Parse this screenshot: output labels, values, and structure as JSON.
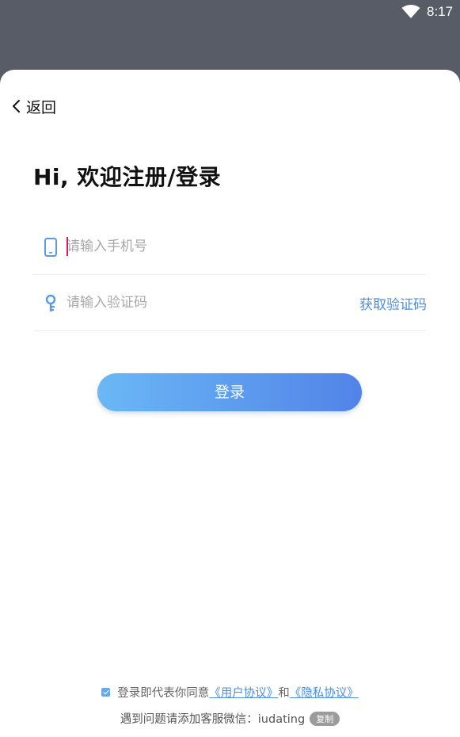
{
  "status_bar": {
    "time": "8:17",
    "wifi_icon": "wifi-icon"
  },
  "nav": {
    "back_label": "返回",
    "back_icon": "chevron-left-icon"
  },
  "title": "Hi, 欢迎注册/登录",
  "phone_field": {
    "placeholder": "请输入手机号",
    "value": "",
    "icon": "phone-icon"
  },
  "code_field": {
    "placeholder": "请输入验证码",
    "value": "",
    "icon": "key-icon",
    "get_code_label": "获取验证码"
  },
  "login_button": {
    "label": "登录"
  },
  "agreement": {
    "checked": true,
    "prefix": "登录即代表你同意",
    "user_agreement": "《用户协议》",
    "and": "和",
    "privacy_agreement": "《隐私协议》"
  },
  "support": {
    "text": "遇到问题请添加客服微信：",
    "wechat_id": "iudating",
    "copy_label": "复制"
  },
  "colors": {
    "accent": "#4a8ee0",
    "button_gradient_start": "#6ab8f5",
    "button_gradient_end": "#5283e8",
    "backdrop": "#575c66"
  }
}
